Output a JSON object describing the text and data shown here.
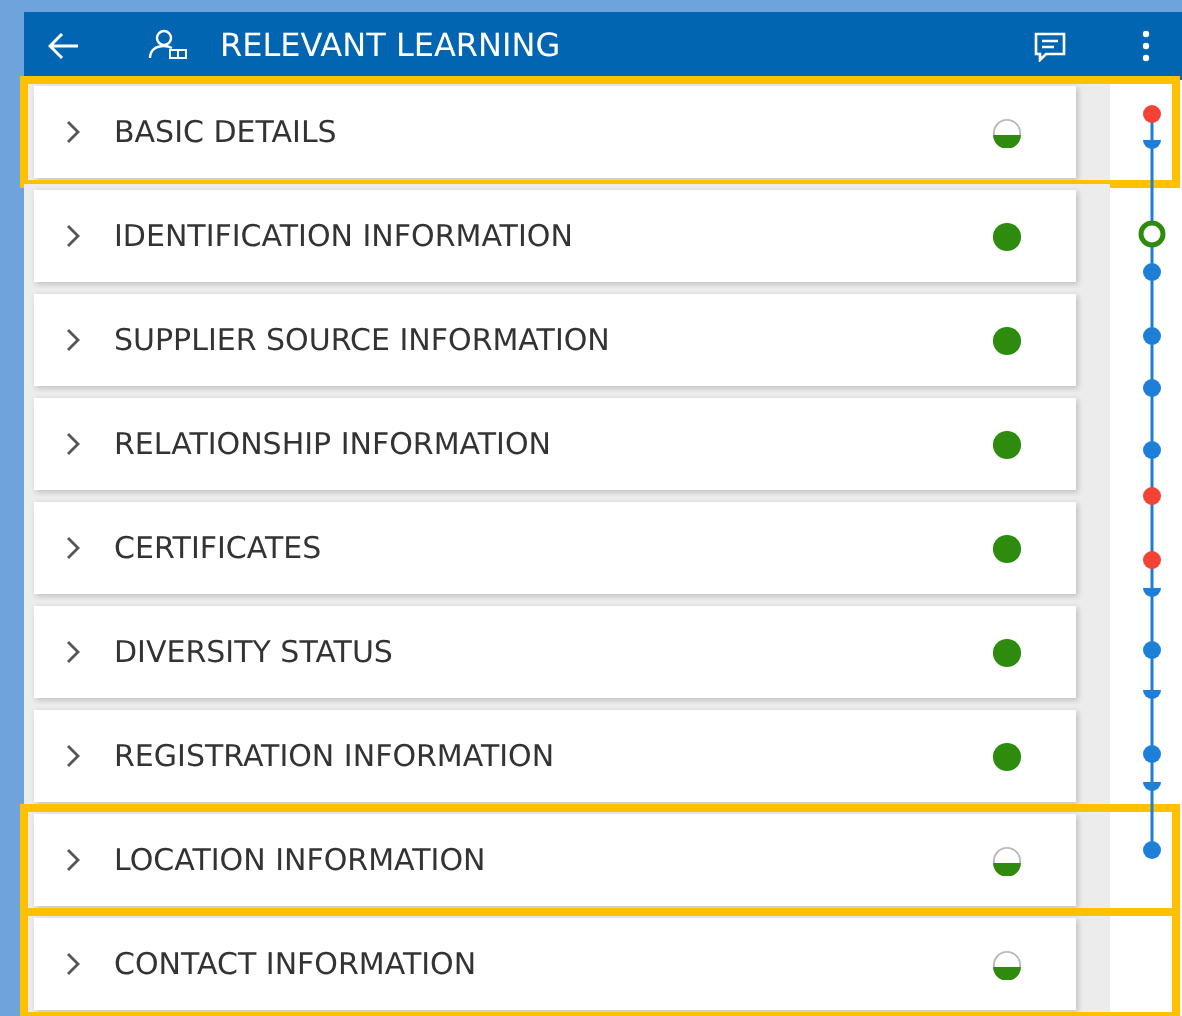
{
  "header": {
    "title": "RELEVANT LEARNING"
  },
  "sections": [
    {
      "label": "BASIC DETAILS",
      "complete": false,
      "highlighted": true
    },
    {
      "label": "IDENTIFICATION INFORMATION",
      "complete": true,
      "highlighted": false
    },
    {
      "label": "SUPPLIER SOURCE INFORMATION",
      "complete": true,
      "highlighted": false
    },
    {
      "label": "RELATIONSHIP INFORMATION",
      "complete": true,
      "highlighted": false
    },
    {
      "label": "CERTIFICATES",
      "complete": true,
      "highlighted": false
    },
    {
      "label": "DIVERSITY STATUS",
      "complete": true,
      "highlighted": false
    },
    {
      "label": "REGISTRATION INFORMATION",
      "complete": true,
      "highlighted": false
    },
    {
      "label": "LOCATION INFORMATION",
      "complete": false,
      "highlighted": true
    },
    {
      "label": "CONTACT INFORMATION",
      "complete": false,
      "highlighted": true
    }
  ],
  "timeline": [
    {
      "kind": "dot",
      "color": "#f44336"
    },
    {
      "kind": "notch",
      "color": "#1e7fd8"
    },
    {
      "kind": "ring",
      "color": "#2e8b0e"
    },
    {
      "kind": "dot",
      "color": "#1e7fd8"
    },
    {
      "kind": "dot",
      "color": "#1e7fd8"
    },
    {
      "kind": "dot",
      "color": "#1e7fd8"
    },
    {
      "kind": "dot",
      "color": "#1e7fd8"
    },
    {
      "kind": "dot",
      "color": "#f44336"
    },
    {
      "kind": "dot",
      "color": "#f44336"
    },
    {
      "kind": "notch",
      "color": "#1e7fd8"
    },
    {
      "kind": "dot",
      "color": "#1e7fd8"
    },
    {
      "kind": "notch",
      "color": "#1e7fd8"
    },
    {
      "kind": "dot",
      "color": "#1e7fd8"
    },
    {
      "kind": "notch",
      "color": "#1e7fd8"
    },
    {
      "kind": "dot",
      "color": "#1e7fd8"
    }
  ]
}
